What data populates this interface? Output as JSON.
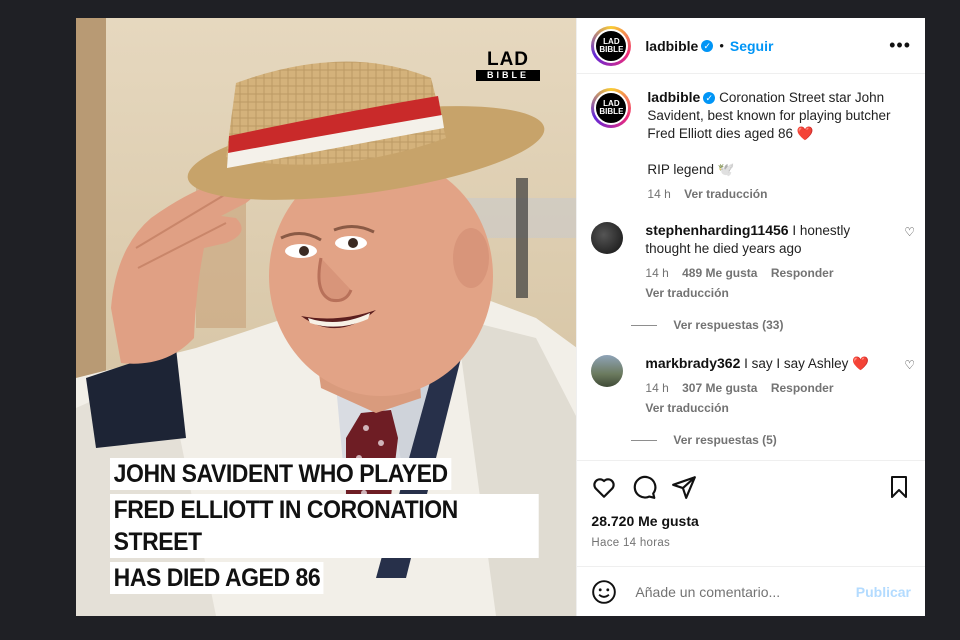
{
  "post": {
    "image_logo": {
      "line1": "LAD",
      "line2": "BIBLE"
    },
    "headline": [
      "JOHN SAVIDENT WHO PLAYED",
      "FRED ELLIOTT IN CORONATION STREET",
      "HAS DIED AGED 86"
    ]
  },
  "header": {
    "avatar_text": "LAD BIBLE",
    "username": "ladbible",
    "follow_label": "Seguir",
    "more_label": "•••"
  },
  "caption": {
    "username": "ladbible",
    "text": "Coronation Street star John Savident, best known for playing butcher Fred Elliott dies aged 86",
    "heart": "❤️",
    "second_line": "RIP legend",
    "second_emoji": "🕊️",
    "time": "14 h",
    "translate": "Ver traducción"
  },
  "comments": [
    {
      "username": "stephenharding11456",
      "text": "I honestly thought he died years ago",
      "time": "14 h",
      "likes": "489 Me gusta",
      "reply": "Responder",
      "translate": "Ver traducción",
      "replies": "Ver respuestas (33)"
    },
    {
      "username": "markbrady362",
      "text": "I say I say Ashley",
      "heart": "❤️",
      "time": "14 h",
      "likes": "307 Me gusta",
      "reply": "Responder",
      "translate": "Ver traducción",
      "replies": "Ver respuestas (5)"
    }
  ],
  "actions": {
    "like_count": "28.720 Me gusta",
    "posted_ago": "Hace 14 horas"
  },
  "add_comment": {
    "placeholder": "Añade un comentario...",
    "publish_label": "Publicar"
  },
  "icons": [
    "heart-icon",
    "comment-icon",
    "share-icon",
    "bookmark-icon",
    "emoji-icon",
    "verified-icon",
    "more-icon"
  ],
  "colors": {
    "accent": "#0095f6",
    "heart": "#ed4956",
    "background": "#1f2025"
  }
}
